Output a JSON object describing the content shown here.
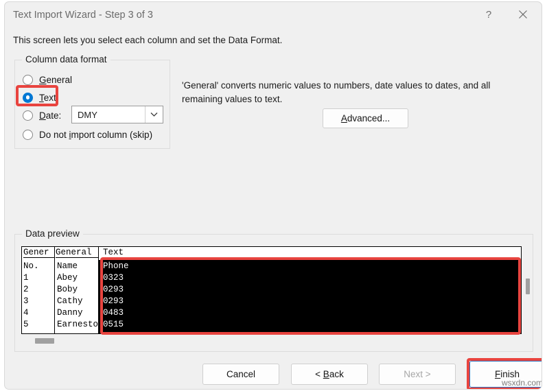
{
  "window": {
    "title": "Text Import Wizard - Step 3 of 3",
    "help_icon": "question-mark-icon",
    "close_icon": "close-icon"
  },
  "intro": {
    "text": "This screen lets you select each column and set the Data Format."
  },
  "column_format_group": {
    "legend": "Column data format",
    "options": [
      {
        "label": "General",
        "mnemonic": "G",
        "selected": false
      },
      {
        "label": "Text",
        "mnemonic": "T",
        "selected": true
      },
      {
        "label": "Date:",
        "mnemonic": "D",
        "selected": false
      },
      {
        "label": "Do not import column (skip)",
        "mnemonic": "i",
        "selected": false
      }
    ],
    "date_combo": {
      "value": "DMY",
      "arrow_icon": "chevron-down-icon"
    }
  },
  "description": {
    "text": "'General' converts numeric values to numbers, date values to dates, and all remaining values to text."
  },
  "advanced_button": {
    "label": "Advanced..."
  },
  "data_preview": {
    "legend": "Data preview",
    "column_headers": [
      "Gener",
      "General",
      "Text"
    ],
    "rows": [
      {
        "no": "No.",
        "name": "Name",
        "phone": "Phone"
      },
      {
        "no": "1",
        "name": "Abey",
        "phone": "0323"
      },
      {
        "no": "2",
        "name": "Boby",
        "phone": "0293"
      },
      {
        "no": "3",
        "name": "Cathy",
        "phone": "0293"
      },
      {
        "no": "4",
        "name": "Danny",
        "phone": "0483"
      },
      {
        "no": "5",
        "name": "Earnesto",
        "phone": "0515"
      }
    ],
    "selected_column_index": 2
  },
  "footer_buttons": {
    "cancel": "Cancel",
    "back": "< Back",
    "next": "Next >",
    "finish": "Finish"
  },
  "watermark": {
    "text": "wsxdn.com"
  },
  "colors": {
    "dialog_background": "#f0f0f0",
    "accent_radio": "#0078d4",
    "annotation_red": "#e8443f",
    "focus_blue": "#2b6fbd",
    "selection_black": "#000000"
  }
}
